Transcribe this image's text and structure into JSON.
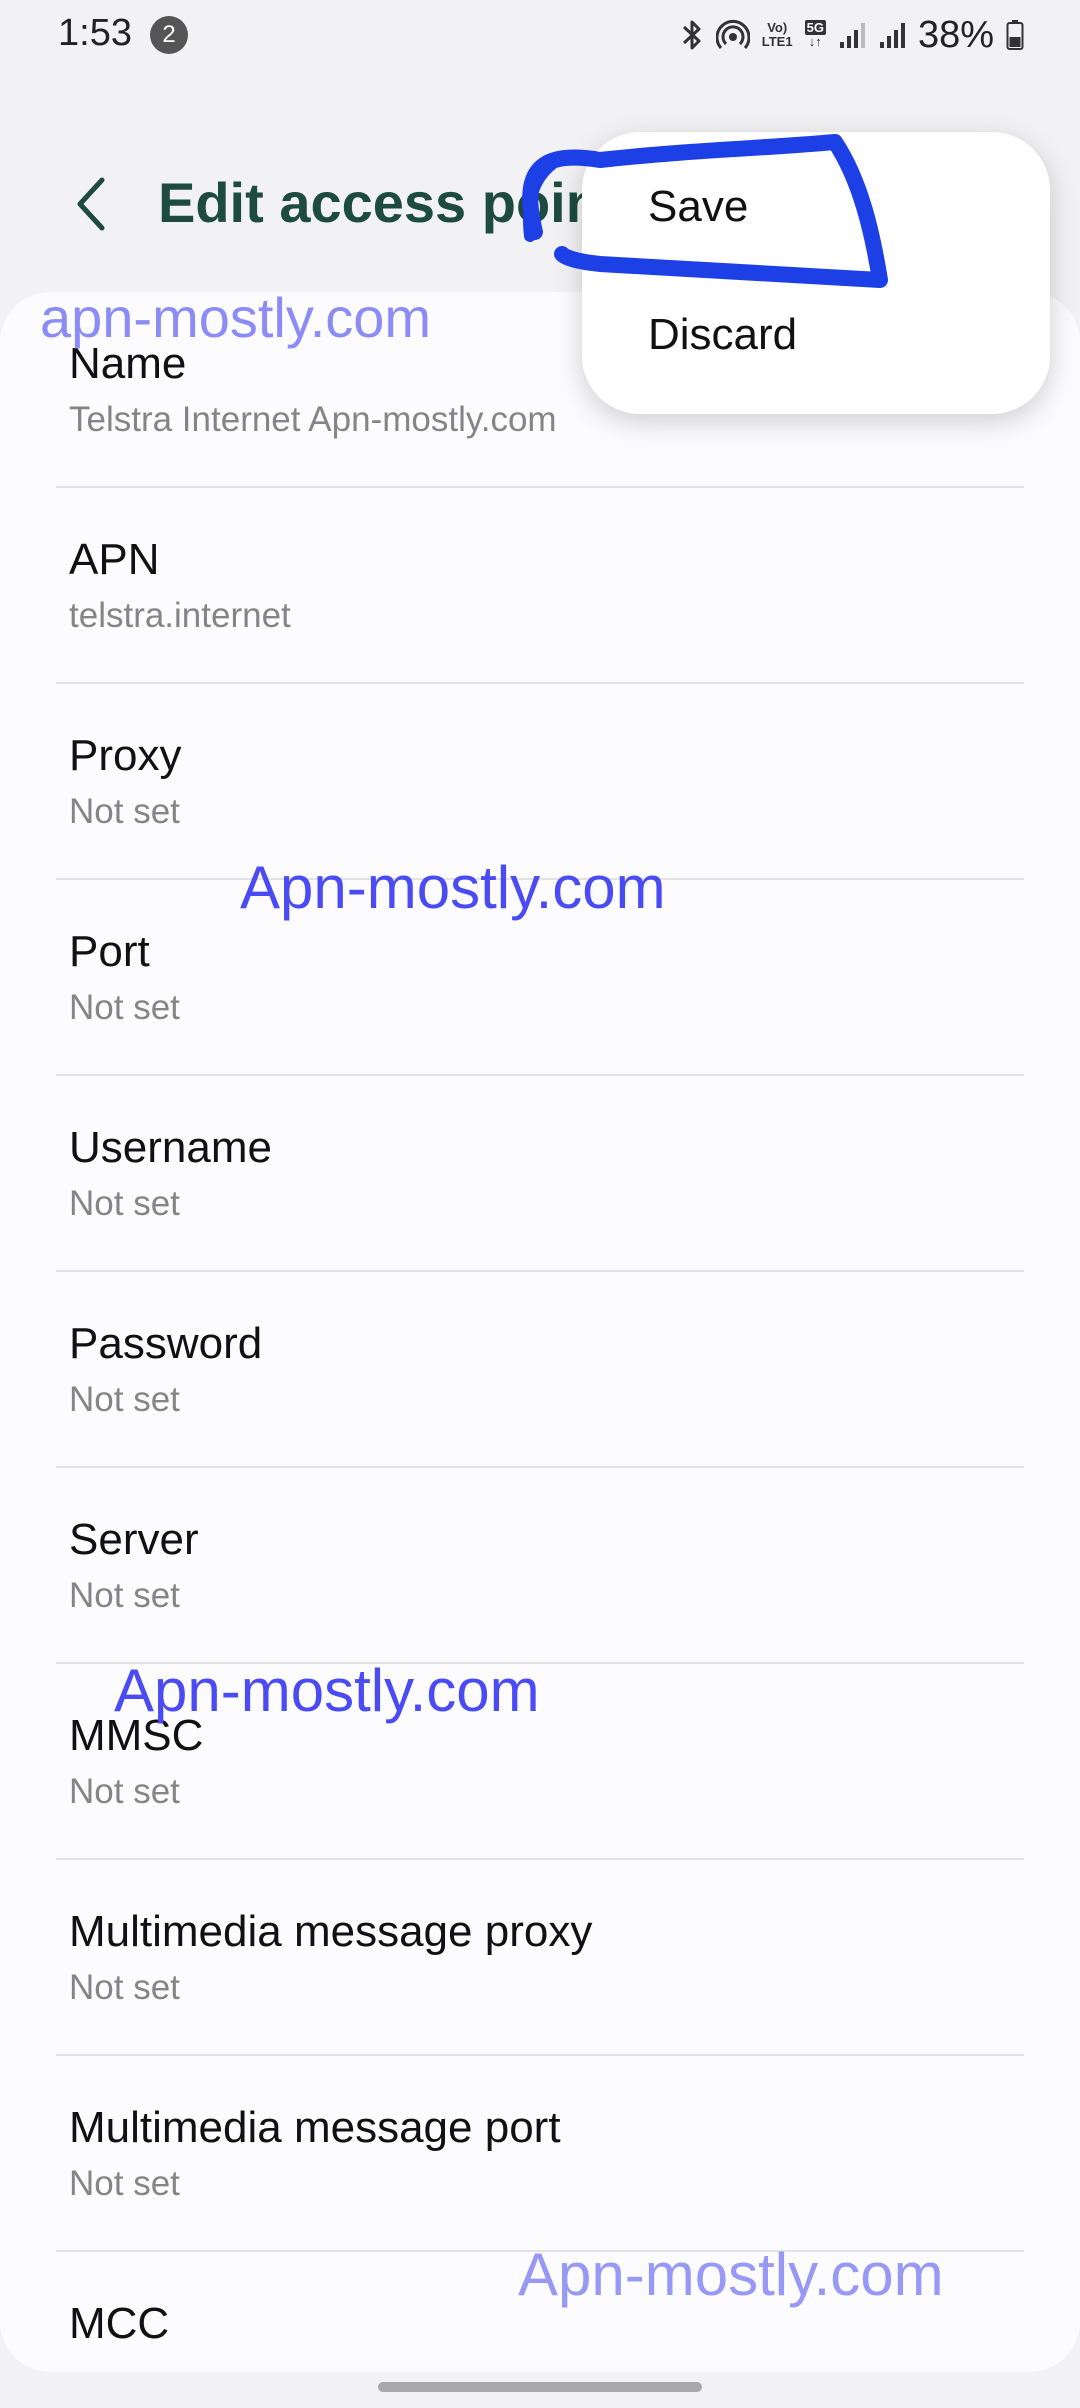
{
  "status_bar": {
    "time": "1:53",
    "notification_count": "2",
    "network_volte": "Vo)",
    "network_lte": "LTE1",
    "network_5g": "5G",
    "battery": "38%"
  },
  "header": {
    "title": "Edit access point",
    "back_icon": "chevron-left-icon"
  },
  "menu": {
    "save_label": "Save",
    "discard_label": "Discard"
  },
  "fields": [
    {
      "label": "Name",
      "value": "Telstra Internet Apn-mostly.com"
    },
    {
      "label": "APN",
      "value": "telstra.internet"
    },
    {
      "label": "Proxy",
      "value": "Not set"
    },
    {
      "label": "Port",
      "value": "Not set"
    },
    {
      "label": "Username",
      "value": "Not set"
    },
    {
      "label": "Password",
      "value": "Not set"
    },
    {
      "label": "Server",
      "value": "Not set"
    },
    {
      "label": "MMSC",
      "value": "Not set"
    },
    {
      "label": "Multimedia message proxy",
      "value": "Not set"
    },
    {
      "label": "Multimedia message port",
      "value": "Not set"
    },
    {
      "label": "MCC",
      "value": ""
    }
  ],
  "watermarks": {
    "wm1": "apn-mostly.com",
    "wm2": "Apn-mostly.com",
    "wm3": "Apn-mostly.com",
    "wm4": "Apn-mostly.com"
  },
  "colors": {
    "title": "#1d4b3e",
    "watermark": "#4b4bf5",
    "scribble": "#1c3fe6",
    "background": "#f2f2f4",
    "card": "#fcfcfe"
  }
}
